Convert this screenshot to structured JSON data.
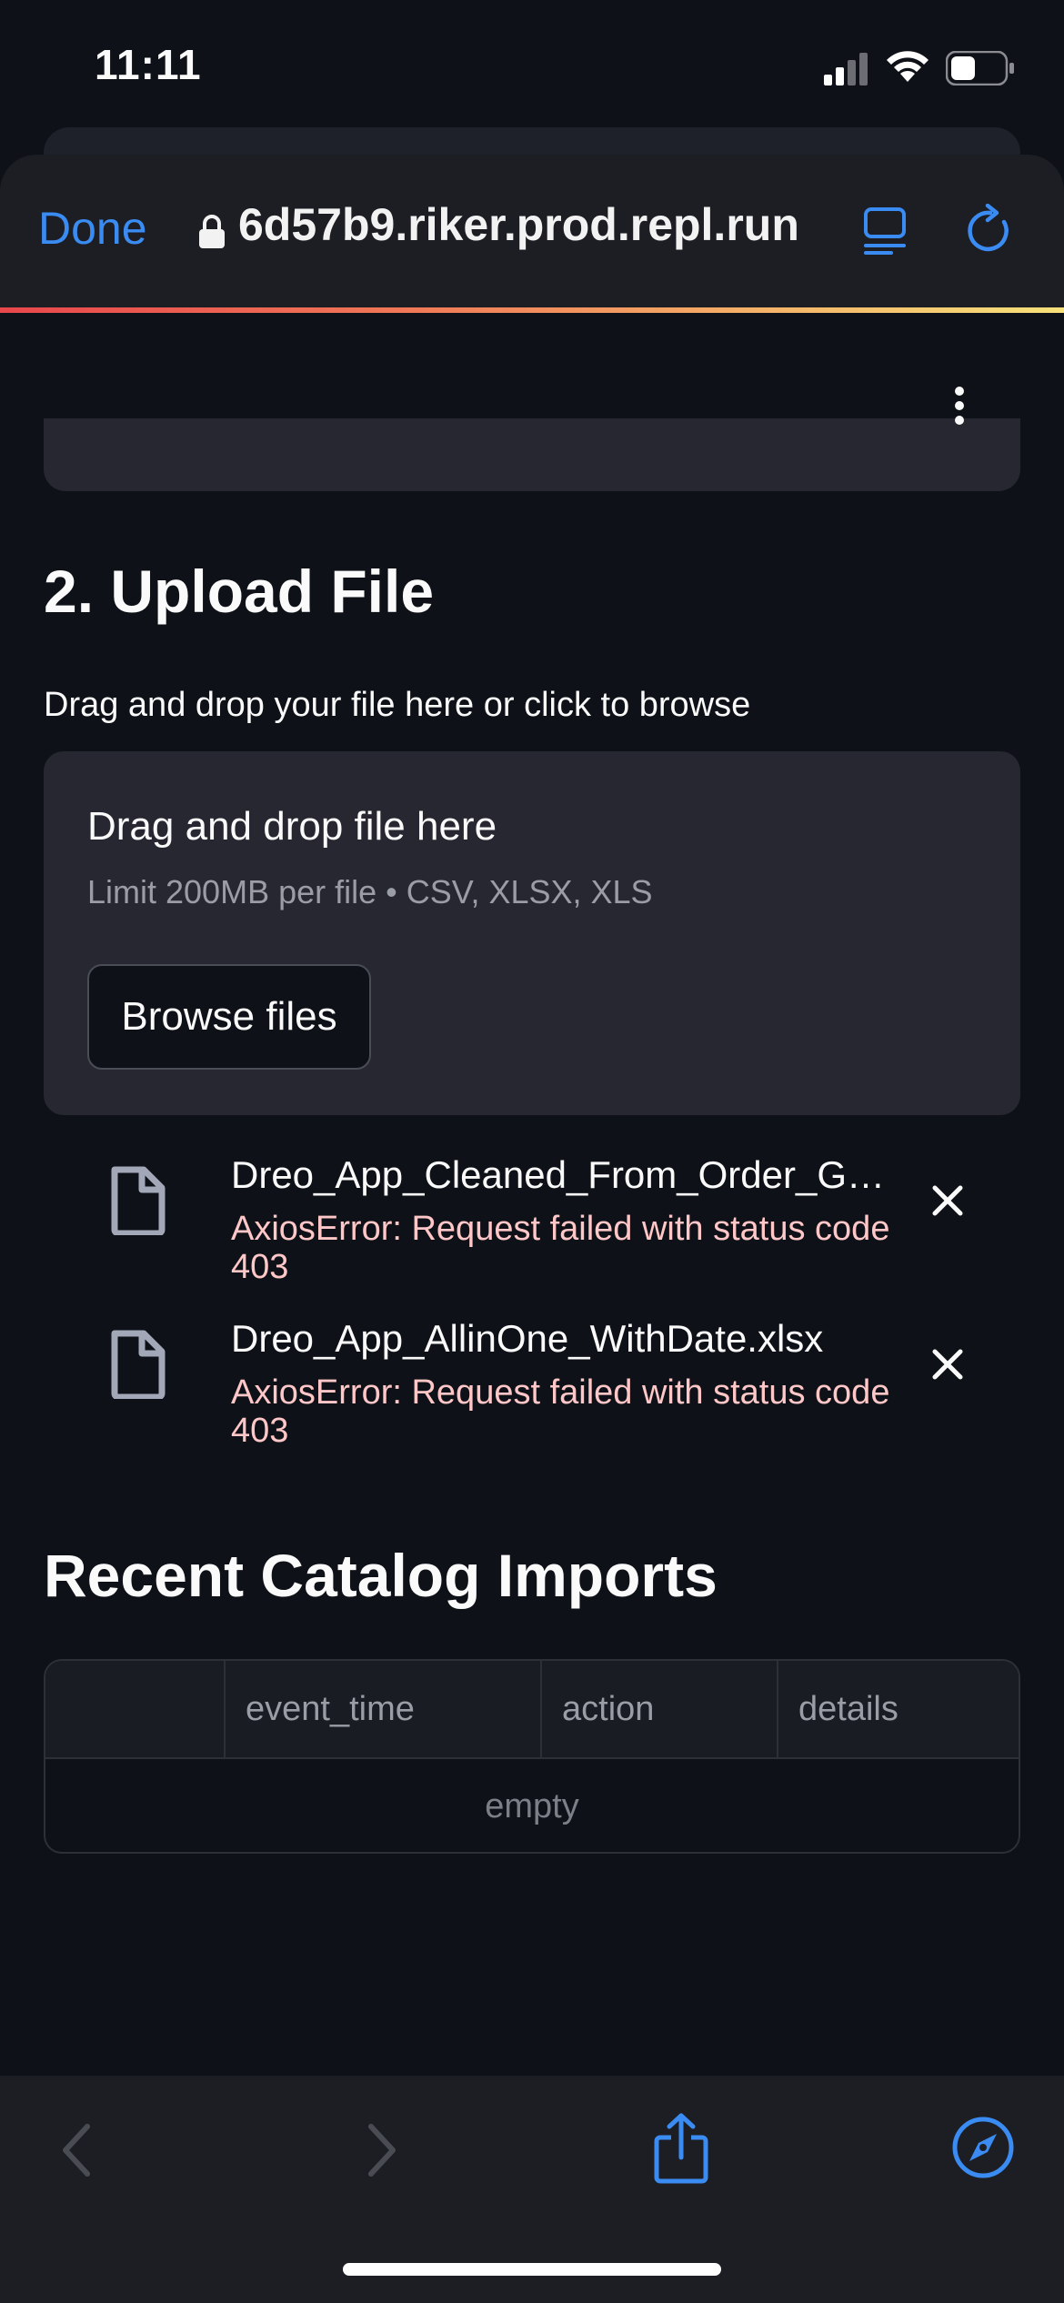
{
  "status_bar": {
    "time": "11:11"
  },
  "browser": {
    "done_label": "Done",
    "url": "6d57b9.riker.prod.repl.run",
    "accent_color": "#3b8cf2"
  },
  "upload_section": {
    "heading": "2. Upload File",
    "caption": "Drag and drop your file here or click to browse",
    "dropzone_title": "Drag and drop file here",
    "dropzone_limit": "Limit 200MB per file • CSV, XLSX, XLS",
    "browse_label": "Browse files"
  },
  "files": [
    {
      "name": "Dreo_App_Cleaned_From_Order_G…",
      "error": "AxiosError: Request failed with status code 403"
    },
    {
      "name": "Dreo_App_AllinOne_WithDate.xlsx",
      "error": "AxiosError: Request failed with status code 403"
    }
  ],
  "recent_section": {
    "heading": "Recent Catalog Imports",
    "columns": [
      "",
      "event_time",
      "action",
      "details"
    ],
    "empty_text": "empty"
  },
  "colors": {
    "background": "#0e1117",
    "card": "#262730",
    "error_text": "#ffc7c7"
  }
}
